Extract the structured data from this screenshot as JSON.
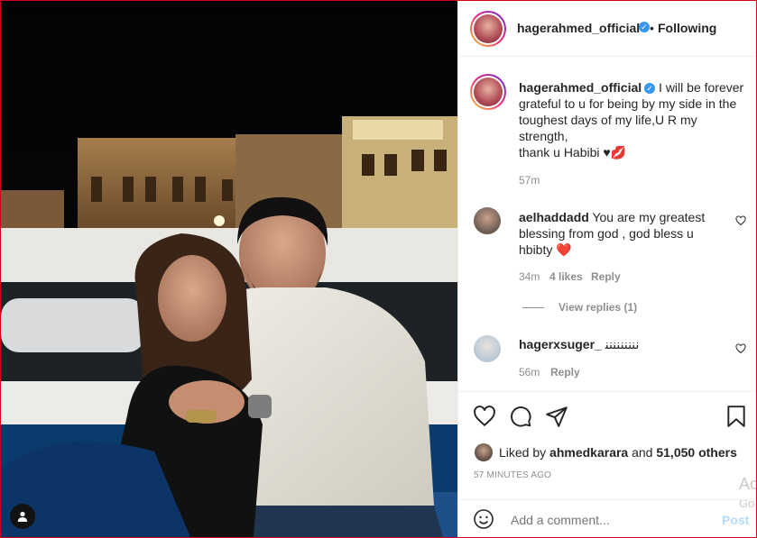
{
  "post": {
    "author": "hagerahmed_official",
    "follow_label": "Following",
    "caption": {
      "username": "hagerahmed_official",
      "text_line1": "I will be forever",
      "text_line2": "grateful to u for being by my side in the",
      "text_line3": "toughest days of my life,U R my",
      "text_line4": "strength,",
      "text_line5": "thank u Habibi ♥💋",
      "time": "57m"
    },
    "comments": [
      {
        "username": "aelhaddadd",
        "text_line1": "You are my greatest",
        "text_line2": "blessing from god , god bless u",
        "text_line3": "hbibty ❤️",
        "time": "34m",
        "likes": "4 likes",
        "reply_label": "Reply",
        "view_replies": "View replies (1)"
      },
      {
        "username": "hagerxsuger_",
        "text": "ﻧﻨﻨﻨﻨﻨﻨﻨﻨ",
        "time": "56m",
        "reply_label": "Reply"
      }
    ],
    "likes": {
      "prefix": "Liked by",
      "liker": "ahmedkarara",
      "and_label": "and",
      "others": "51,050 others"
    },
    "timestamp": "57 MINUTES AGO",
    "add_comment": {
      "placeholder": "Add a comment...",
      "post_label": "Post"
    },
    "watermark_line1": "Ac",
    "watermark_line2": "Go"
  },
  "icons": {
    "verified": "verified-badge-icon",
    "heart": "heart-icon",
    "comment": "comment-bubble-icon",
    "share": "paper-plane-icon",
    "save": "bookmark-icon",
    "emoji": "emoji-icon",
    "user": "user-tag-icon"
  },
  "colors": {
    "accent": "#0095f6",
    "verified": "#3897f0",
    "text": "#262626",
    "muted": "#8e8e8e",
    "heart_red": "#ed4956"
  }
}
